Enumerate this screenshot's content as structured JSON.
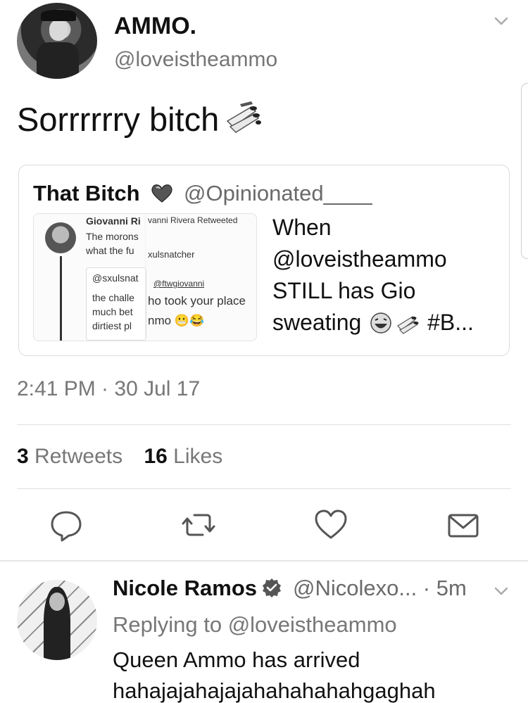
{
  "tweet": {
    "display_name": "AMMO.",
    "handle": "@loveistheammo",
    "text": "Sorrrrrry bitch",
    "timestamp": "2:41 PM · 30 Jul 17",
    "retweets_count": "3",
    "retweets_label": "Retweets",
    "likes_count": "16",
    "likes_label": "Likes"
  },
  "quote": {
    "name": "That Bitch",
    "handle": "@Opinionated____",
    "body_lines": [
      "When",
      "@loveistheammo",
      "STILL has Gio",
      "sweating",
      "#B..."
    ],
    "media": {
      "line1": "Giovanni Ri",
      "line1b": "vanni Rivera Retweeted",
      "line2": "The morons",
      "line3": "what the fu",
      "line3b": "xulsnatcher",
      "inner1": "@sxulsnat",
      "inner1b": "@ftwgiovanni",
      "inner2": "the challe",
      "inner3": "much bet",
      "inner3b": "ho took your place",
      "inner4": "dirtiest pl",
      "inner4b": "nmo"
    }
  },
  "actions": [
    "reply-icon",
    "retweet-icon",
    "like-icon",
    "share-icon"
  ],
  "reply": {
    "display_name": "Nicole Ramos",
    "handle_time": "@Nicolexo... · 5m",
    "replying_to": "Replying to @loveistheammo",
    "line1": "Queen Ammo has arrived",
    "line2": "hahajajahajajahahahahahgaghah"
  }
}
